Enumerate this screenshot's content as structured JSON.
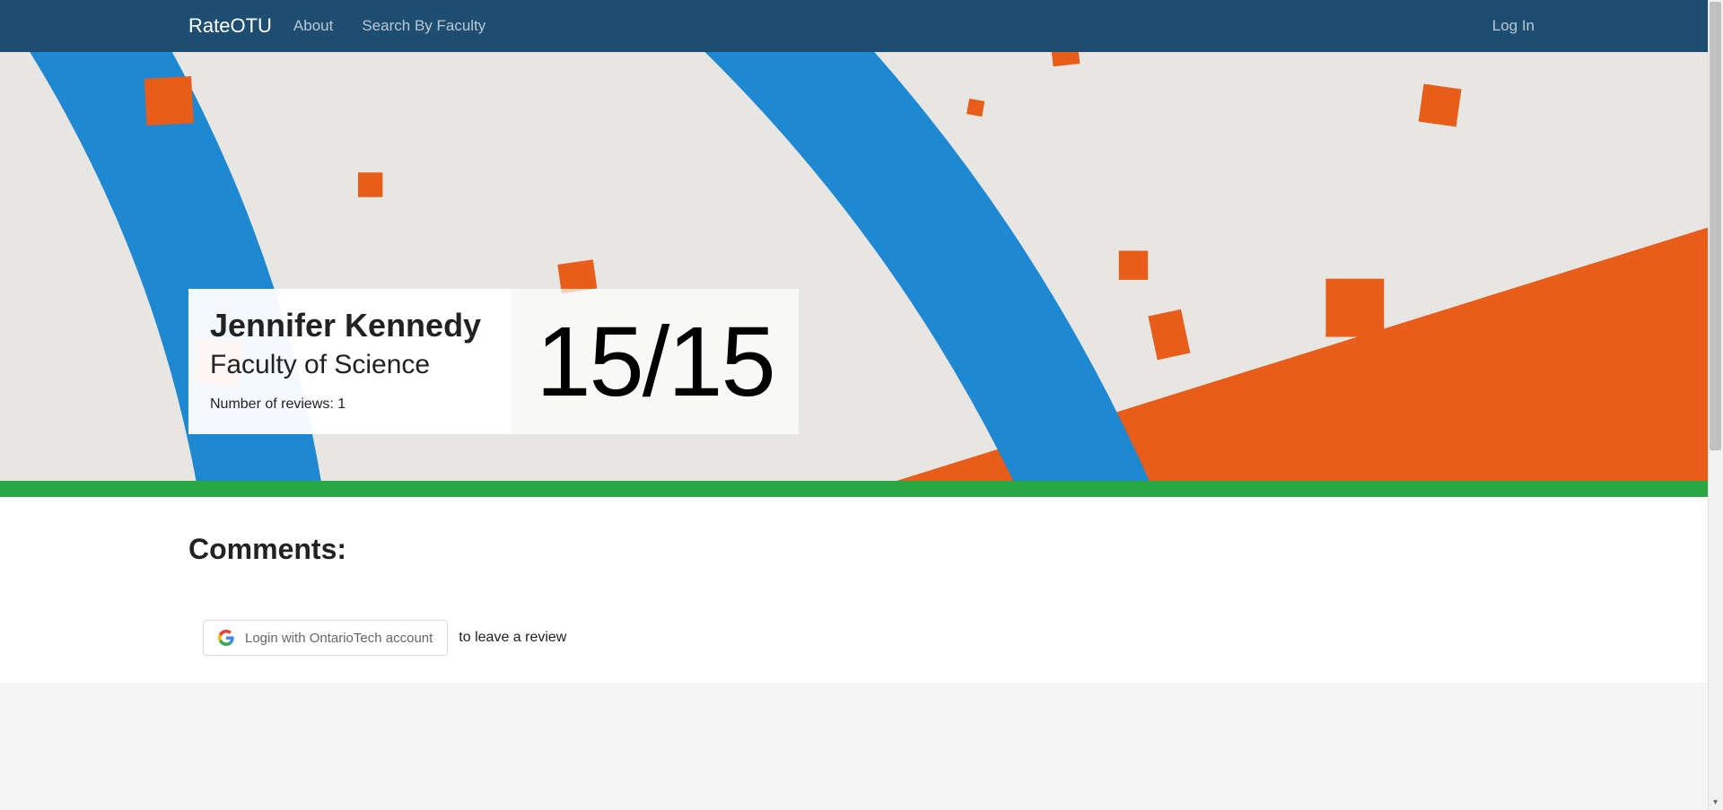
{
  "nav": {
    "brand": "RateOTU",
    "about": "About",
    "search": "Search By Faculty",
    "login": "Log In"
  },
  "prof": {
    "name": "Jennifer Kennedy",
    "faculty": "Faculty of Science",
    "reviews_label": "Number of reviews: 1",
    "score": "15/15"
  },
  "comments": {
    "heading": "Comments:",
    "login_btn": "Login with OntarioTech account",
    "login_suffix": "to leave a review"
  }
}
